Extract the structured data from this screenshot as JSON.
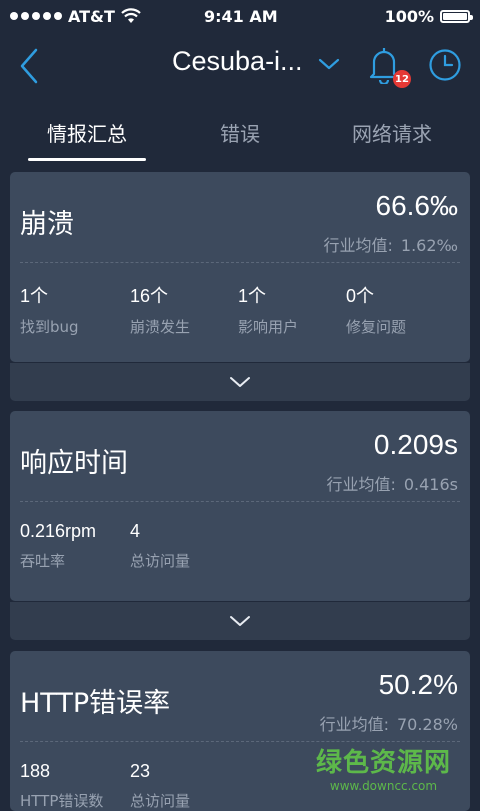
{
  "status": {
    "carrier": "AT&T",
    "time": "9:41 AM",
    "battery": "100%"
  },
  "nav": {
    "title": "Cesuba-i...",
    "notification_count": "12"
  },
  "tabs": [
    {
      "label": "情报汇总",
      "active": true
    },
    {
      "label": "错误",
      "active": false
    },
    {
      "label": "网络请求",
      "active": false
    }
  ],
  "cards": [
    {
      "title": "崩溃",
      "value": "66.6‰",
      "avg_label": "行业均值:",
      "avg_value": "1.62‰",
      "stats": [
        {
          "num": "1个",
          "label": "找到bug"
        },
        {
          "num": "16个",
          "label": "崩溃发生"
        },
        {
          "num": "1个",
          "label": "影响用户"
        },
        {
          "num": "0个",
          "label": "修复问题"
        }
      ]
    },
    {
      "title": "响应时间",
      "value": "0.209s",
      "avg_label": "行业均值:",
      "avg_value": "0.416s",
      "stats": [
        {
          "num": "0.216rpm",
          "label": "吞吐率"
        },
        {
          "num": "4",
          "label": "总访问量"
        }
      ]
    },
    {
      "title": "HTTP错误率",
      "value": "50.2%",
      "avg_label": "行业均值:",
      "avg_value": "70.28%",
      "stats": [
        {
          "num": "188",
          "label": "HTTP错误数"
        },
        {
          "num": "23",
          "label": "总访问量"
        }
      ]
    }
  ],
  "watermark": {
    "main": "绿色资源网",
    "sub": "www.downcc.com"
  },
  "colors": {
    "background": "#20293a",
    "card": "#3d4a5d",
    "accent": "#2f9de0",
    "badge": "#e53935"
  }
}
